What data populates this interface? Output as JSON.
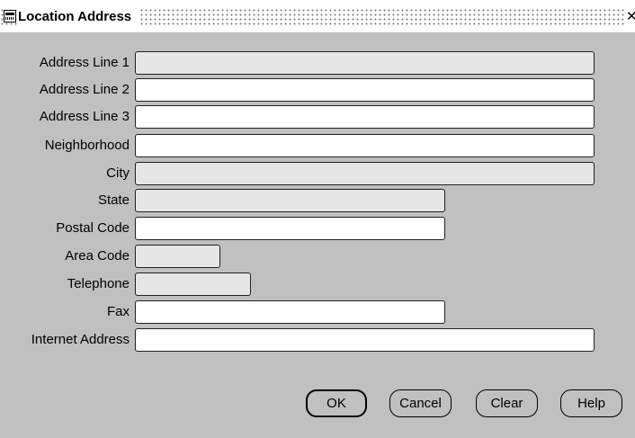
{
  "window": {
    "title": "Location Address",
    "close_glyph": "✕",
    "app_icon": "oracle-app-icon"
  },
  "form": {
    "fields": [
      {
        "label": "Address Line 1",
        "value": "",
        "state": "read-only"
      },
      {
        "label": "Address Line 2",
        "value": "",
        "state": "editable"
      },
      {
        "label": "Address Line 3",
        "value": "",
        "state": "editable"
      },
      {
        "label": "Neighborhood",
        "value": "",
        "state": "editable"
      },
      {
        "label": "City",
        "value": "",
        "state": "read-only"
      },
      {
        "label": "State",
        "value": "",
        "state": "read-only"
      },
      {
        "label": "Postal Code",
        "value": "",
        "state": "editable"
      },
      {
        "label": "Area Code",
        "value": "",
        "state": "read-only"
      },
      {
        "label": "Telephone",
        "value": "",
        "state": "read-only"
      },
      {
        "label": "Fax",
        "value": "",
        "state": "editable"
      },
      {
        "label": "Internet Address",
        "value": "",
        "state": "editable"
      }
    ]
  },
  "buttons": {
    "ok": "OK",
    "cancel": "Cancel",
    "clear": "Clear",
    "help": "Help"
  },
  "colors": {
    "background": "#c0c0c0",
    "readonly_field": "#e6e6e6",
    "editable_field": "#ffffff"
  }
}
